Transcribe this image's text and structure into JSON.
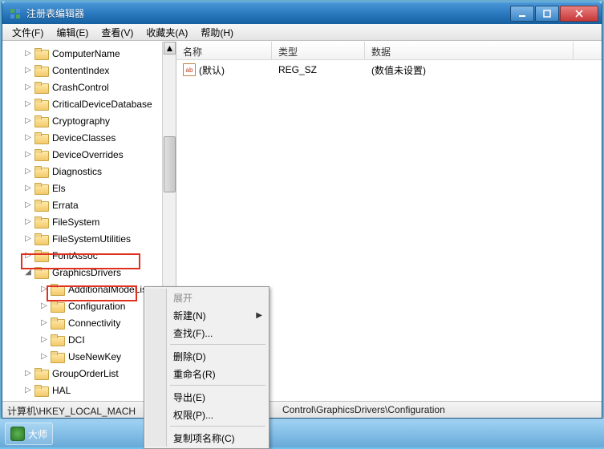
{
  "window": {
    "title": "注册表编辑器",
    "buttons": {
      "min": "minimize",
      "max": "maximize",
      "close": "close"
    }
  },
  "menubar": [
    "文件(F)",
    "编辑(E)",
    "查看(V)",
    "收藏夹(A)",
    "帮助(H)"
  ],
  "tree": {
    "depth1": [
      "ComputerName",
      "ContentIndex",
      "CrashControl",
      "CriticalDeviceDatabase",
      "Cryptography",
      "DeviceClasses",
      "DeviceOverrides",
      "Diagnostics",
      "Els",
      "Errata",
      "FileSystem",
      "FileSystemUtilities",
      "FontAssoc"
    ],
    "graphics": {
      "label": "GraphicsDrivers",
      "children": [
        "AdditionalModeLists",
        "Configuration",
        "Connectivity",
        "DCI",
        "UseNewKey"
      ]
    },
    "after": [
      "GroupOrderList",
      "HAL"
    ]
  },
  "list": {
    "headers": {
      "name": "名称",
      "type": "类型",
      "data": "数据"
    },
    "cols": {
      "name": 119,
      "type": 116,
      "data": 260
    },
    "rows": [
      {
        "icon": "ab",
        "name": "(默认)",
        "type": "REG_SZ",
        "data": "(数值未设置)"
      }
    ]
  },
  "context": {
    "expand": "展开",
    "new": "新建(N)",
    "find": "查找(F)...",
    "delete": "删除(D)",
    "rename": "重命名(R)",
    "export": "导出(E)",
    "perm": "权限(P)...",
    "copykey": "复制项名称(C)"
  },
  "statusbar": {
    "prefix": "计算机\\HKEY_LOCAL_MACH",
    "suffix": "Control\\GraphicsDrivers\\Configuration"
  },
  "taskbar": {
    "btn": "大师"
  }
}
